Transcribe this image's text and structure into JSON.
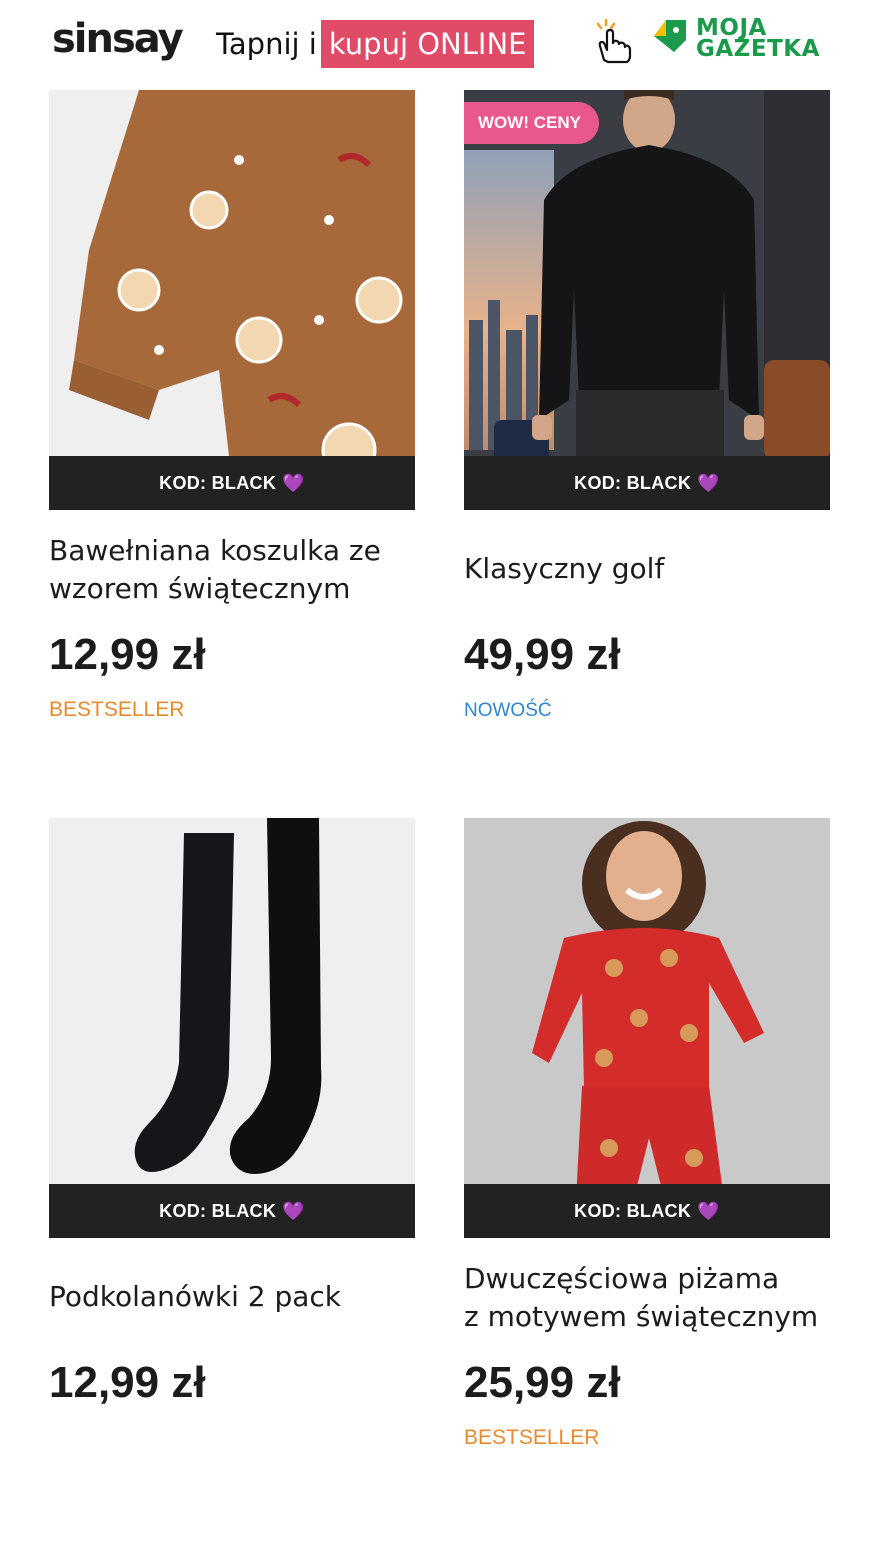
{
  "header": {
    "brand": "sinsay",
    "promo_prefix": "Tapnij i",
    "promo_highlight": "kupuj ONLINE",
    "gazetka_line1": "MOJA",
    "gazetka_line2": "GAZETKA"
  },
  "colors": {
    "promo_highlight_bg": "#e04b68",
    "code_bar_bg": "#222222",
    "badge_bg": "#e8578d",
    "bestseller": "#e88a2b",
    "new": "#2f86cf",
    "gazetka_green": "#1a9a4a"
  },
  "products": [
    {
      "name_line1": "Bawełniana koszulka ze",
      "name_line2": "wzorem świątecznym",
      "price": "12,99 zł",
      "code": "KOD: BLACK",
      "tag": "BESTSELLER",
      "badge": ""
    },
    {
      "name_line1": "Klasyczny golf",
      "name_line2": "",
      "price": "49,99 zł",
      "code": "KOD: BLACK",
      "tag": "NOWOŚĆ",
      "badge": "WOW! CENY"
    },
    {
      "name_line1": "Podkolanówki 2 pack",
      "name_line2": "",
      "price": "12,99 zł",
      "code": "KOD: BLACK",
      "tag": "",
      "badge": ""
    },
    {
      "name_line1": "Dwuczęściowa piżama",
      "name_line2": "z motywem świątecznym",
      "price": "25,99 zł",
      "code": "KOD: BLACK",
      "tag": "BESTSELLER",
      "badge": ""
    }
  ],
  "icons": {
    "code_heart": "💜",
    "tap": "hand-tap-icon",
    "gazetka": "gazetka-logo-icon"
  }
}
